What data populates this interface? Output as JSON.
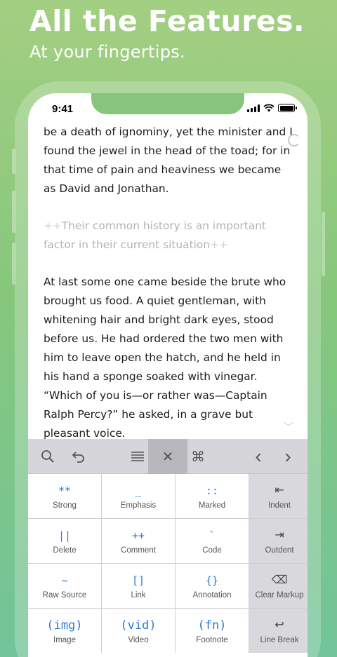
{
  "promo": {
    "headline": "All the Features.",
    "subline": "At your fingertips."
  },
  "status_bar": {
    "time": "9:41"
  },
  "document": {
    "paragraph_1": "be a death of ignominy, yet the minister and I found the jewel in the head of the toad; for in that time of pain and heaviness we became as David and Jonathan.",
    "comment": {
      "open_marker": "++",
      "text": "Their common history is an important factor in their current situation",
      "close_marker": "++"
    },
    "paragraph_2": "At last some one came beside the brute who brought us food. A quiet gentleman, with whitening hair and bright dark eyes, stood before us. He had ordered the two men with him to leave open the hatch, and he held in his hand a sponge soaked with vinegar. “Which of you is—or rather was—Captain Ralph Percy?” he asked, in a grave but pleasant voice."
  },
  "toolbar": {
    "icons": {
      "search": "⚲",
      "undo": "↶",
      "menu": "☰",
      "close": "✕",
      "command": "⌘",
      "prev": "‹",
      "next": "›"
    }
  },
  "keys": [
    {
      "symbol": "**",
      "label": "Strong"
    },
    {
      "symbol": "_",
      "label": "Emphasis"
    },
    {
      "symbol": "::",
      "label": "Marked"
    },
    {
      "symbol": "⇤",
      "label": "Indent"
    },
    {
      "symbol": "||",
      "label": "Delete"
    },
    {
      "symbol": "++",
      "label": "Comment"
    },
    {
      "symbol": "`",
      "label": "Code"
    },
    {
      "symbol": "⇥",
      "label": "Outdent"
    },
    {
      "symbol": "~",
      "label": "Raw Source"
    },
    {
      "symbol": "[]",
      "label": "Link"
    },
    {
      "symbol": "{}",
      "label": "Annotation"
    },
    {
      "symbol": "⌫",
      "label": "Clear Markup"
    },
    {
      "symbol": "(img)",
      "label": "Image"
    },
    {
      "symbol": "(vid)",
      "label": "Video"
    },
    {
      "symbol": "(fn)",
      "label": "Footnote"
    },
    {
      "symbol": "↩",
      "label": "Line Break"
    }
  ],
  "colors": {
    "accent": "#2f7bd8",
    "background_top": "#a3cf82",
    "background_bottom": "#72c49a"
  }
}
